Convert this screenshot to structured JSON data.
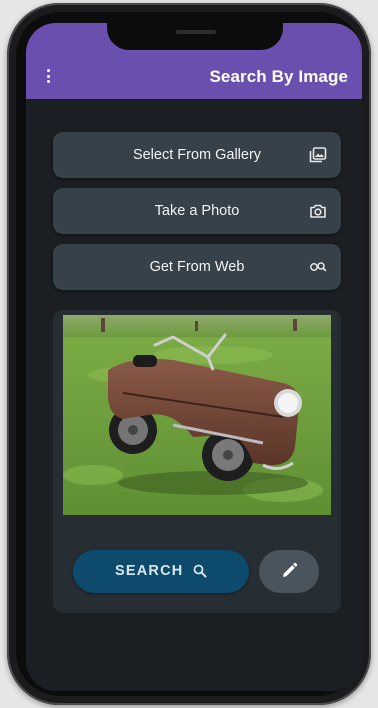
{
  "app_bar": {
    "title": "Search By Image",
    "menu_icon": "more-vert-icon",
    "color": "#6a4fae"
  },
  "options": [
    {
      "label": "Select From Gallery",
      "icon": "gallery-icon"
    },
    {
      "label": "Take a Photo",
      "icon": "camera-icon"
    },
    {
      "label": "Get From Web",
      "icon": "web-search-icon"
    }
  ],
  "preview": {
    "image": "selected-photo"
  },
  "actions": {
    "search_label": "SEARCH",
    "search_icon": "search-icon",
    "edit_icon": "edit-icon"
  },
  "colors": {
    "background": "#1b1e22",
    "button": "#36414a",
    "search_button": "#0d4a6b",
    "edit_button": "#4a545c"
  }
}
